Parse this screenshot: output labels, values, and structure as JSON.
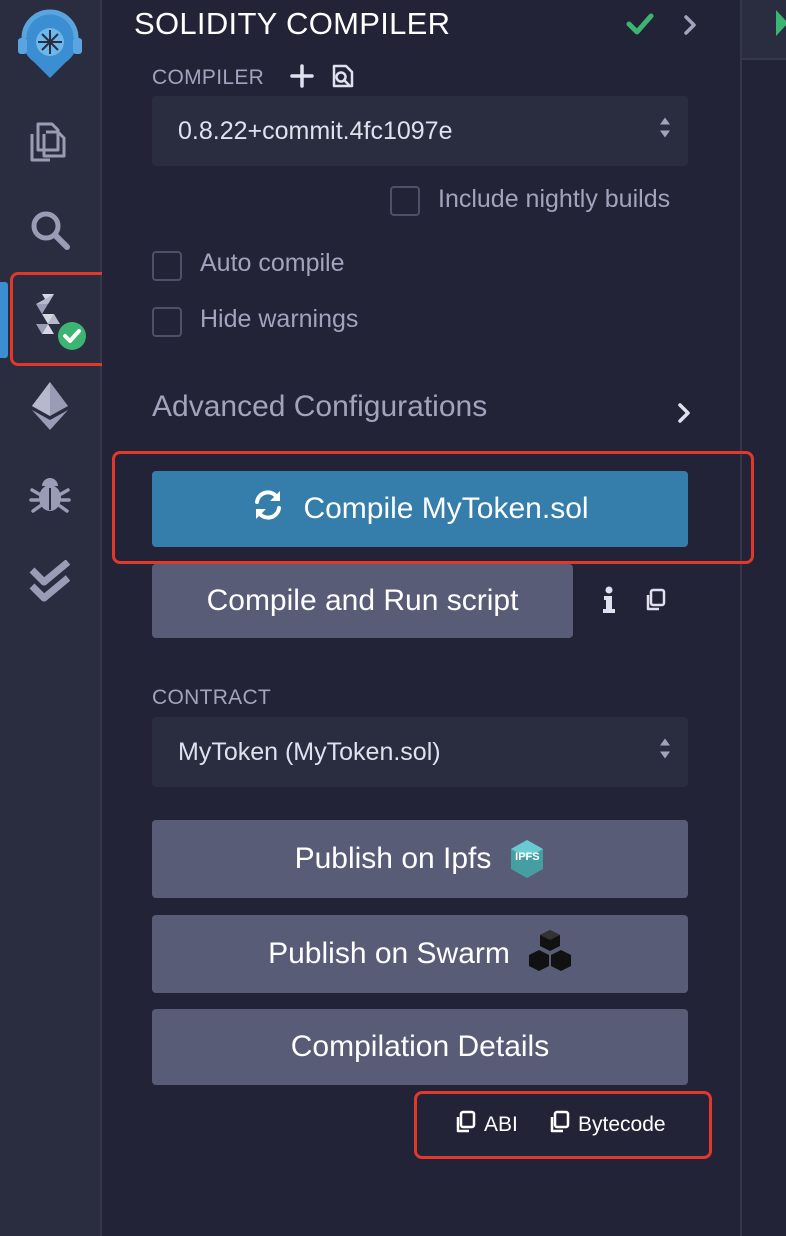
{
  "panel": {
    "title": "SOLIDITY COMPILER"
  },
  "compiler": {
    "label": "COMPILER",
    "version": "0.8.22+commit.4fc1097e",
    "nightly_label": "Include nightly builds",
    "nightly_checked": false
  },
  "options": {
    "auto_compile": "Auto compile",
    "hide_warnings": "Hide warnings"
  },
  "advanced": {
    "label": "Advanced Configurations"
  },
  "buttons": {
    "compile": "Compile MyToken.sol",
    "compile_run": "Compile and Run script",
    "publish_ipfs": "Publish on Ipfs",
    "ipfs_badge": "IPFS",
    "publish_swarm": "Publish on Swarm",
    "details": "Compilation Details"
  },
  "contract": {
    "label": "CONTRACT",
    "selected": "MyToken (MyToken.sol)"
  },
  "copy_links": {
    "abi": "ABI",
    "bytecode": "Bytecode"
  },
  "sidebar": {
    "icons": [
      "remix-logo-icon",
      "file-explorer-icon",
      "search-icon",
      "solidity-compiler-icon",
      "deploy-ethereum-icon",
      "debugger-bug-icon",
      "testing-check-icon"
    ],
    "active": "solidity-compiler-icon"
  },
  "colors": {
    "background": "#222336",
    "panel_light": "#2a2c3f",
    "button": "#595c76",
    "primary": "#357dab",
    "success": "#3cb572",
    "highlight": "#e0392b"
  }
}
